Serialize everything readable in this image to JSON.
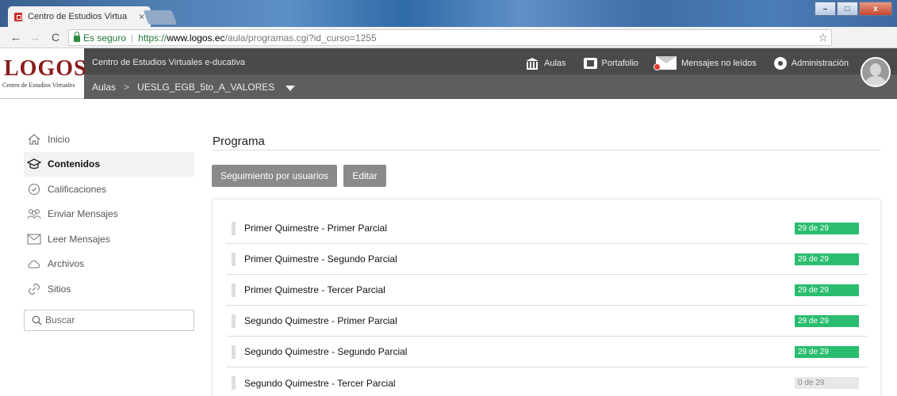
{
  "browser": {
    "tab_title": "Centro de Estudios Virtual",
    "tab_close": "×",
    "secure_label": "Es seguro",
    "separator": "|",
    "url_scheme": "https://",
    "url_host": "www.logos.ec",
    "url_path": "/aula/programas.cgi?id_curso=1255",
    "window_buttons": {
      "minimize": "–",
      "maximize": "□",
      "close": "x"
    }
  },
  "header": {
    "logo": "LOGOS",
    "logo_sub": "Centro de Estudios Virtuales",
    "title": "Centro de Estudios Virtuales e-ducativa",
    "breadcrumb": {
      "root": "Aulas",
      "separator": ">",
      "current": "UESLG_EGB_5to_A_VALORES"
    },
    "nav": {
      "aulas": "Aulas",
      "portafolio": "Portafolio",
      "mensajes": "Mensajes no leídos",
      "admin": "Administración"
    }
  },
  "sidebar": {
    "items": [
      {
        "label": "Inicio",
        "icon": "home-icon",
        "active": false
      },
      {
        "label": "Contenidos",
        "icon": "graduation-cap-icon",
        "active": true
      },
      {
        "label": "Calificaciones",
        "icon": "check-circle-icon",
        "active": false
      },
      {
        "label": "Enviar Mensajes",
        "icon": "users-icon",
        "active": false
      },
      {
        "label": "Leer Mensajes",
        "icon": "envelope-icon",
        "active": false
      },
      {
        "label": "Archivos",
        "icon": "cloud-icon",
        "active": false
      },
      {
        "label": "Sitios",
        "icon": "link-icon",
        "active": false
      }
    ],
    "search_placeholder": "Buscar"
  },
  "main": {
    "title": "Programa",
    "buttons": {
      "seguimiento": "Seguimiento por usuarios",
      "editar": "Editar"
    },
    "rows": [
      {
        "label": "Primer Quimestre - Primer Parcial",
        "progress": "29 de 29",
        "complete": true
      },
      {
        "label": "Primer Quimestre - Segundo Parcial",
        "progress": "29 de 29",
        "complete": true
      },
      {
        "label": "Primer Quimestre - Tercer Parcial",
        "progress": "29 de 29",
        "complete": true
      },
      {
        "label": "Segundo Quimestre - Primer Parcial",
        "progress": "29 de 29",
        "complete": true
      },
      {
        "label": "Segundo Quimestre - Segundo Parcial",
        "progress": "29 de 29",
        "complete": true
      },
      {
        "label": "Segundo Quimestre - Tercer Parcial",
        "progress": "0 de 29",
        "complete": false
      }
    ]
  },
  "colors": {
    "complete": "#2bbd6f",
    "pending": "#e8e8e8",
    "header": "#5e5e5e",
    "logo": "#8a1c1c"
  }
}
